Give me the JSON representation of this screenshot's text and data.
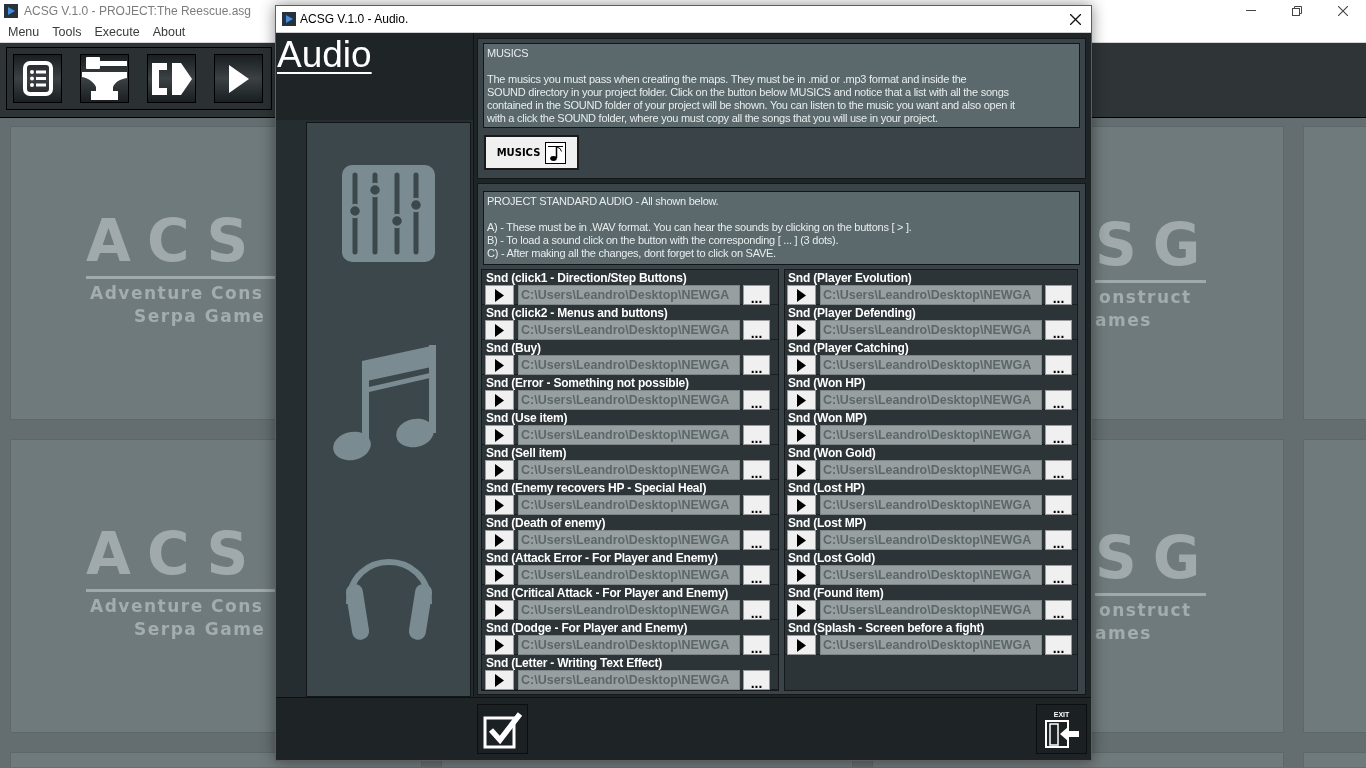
{
  "main_window": {
    "title": "ACSG V.1.0 - PROJECT:The Reescue.asg",
    "menu": [
      {
        "label": "Menu"
      },
      {
        "label": "Tools"
      },
      {
        "label": "Execute"
      },
      {
        "label": "About"
      }
    ]
  },
  "workspace": {
    "tile_logos": [
      {
        "lines": [
          "ACS",
          "Adventure Cons",
          "Serpa Game"
        ]
      },
      {
        "lines": [
          "SG",
          "onstruct",
          "ames"
        ]
      },
      {
        "lines": [
          "ACS",
          "Adventure Cons",
          "Serpa Game"
        ]
      },
      {
        "lines": [
          "SG",
          "onstruct",
          "ames"
        ]
      }
    ]
  },
  "dialog": {
    "title": "ACSG V.1.0 - Audio.",
    "heading": "Audio",
    "musics": {
      "title": "MUSICS",
      "description": "The musics you must pass when creating the maps. They must be in .mid or .mp3 format and inside the\nSOUND directory in your project folder. Click on the button below MUSICS and notice that a list with all the songs\ncontained in the SOUND folder of your project will be shown. You can listen to the music you want and also open it\nwith a click the SOUND folder, where you must copy all the songs that you will use in your project.",
      "button": "MUSICS"
    },
    "standard_audio": {
      "title": "PROJECT STANDARD AUDIO - All shown below.",
      "notes": [
        "A) - These must be in .WAV format. You can hear the sounds by clicking on the buttons [ > ].",
        "B) - To load a sound click on the button with the corresponding [ ... ] (3 dots).",
        "C) - After making all the changes, dont forget to click on SAVE."
      ],
      "columns": [
        {
          "sounds": [
            {
              "label": "Snd (click1 - Direction/Step Buttons)",
              "path": "C:\\Users\\Leandro\\Desktop\\NEWGA",
              "disabled": true,
              "browse": "..."
            },
            {
              "label": "Snd (click2 - Menus and buttons)",
              "path": "C:\\Users\\Leandro\\Desktop\\NEWGA",
              "disabled": true,
              "browse": "..."
            },
            {
              "label": "Snd (Buy)",
              "path": "C:\\Users\\Leandro\\Desktop\\NEWGA",
              "disabled": true,
              "browse": "..."
            },
            {
              "label": "Snd (Error - Something not possible)",
              "path": "C:\\Users\\Leandro\\Desktop\\NEWGA",
              "disabled": true,
              "browse": "..."
            },
            {
              "label": "Snd (Use item)",
              "path": "C:\\Users\\Leandro\\Desktop\\NEWGA",
              "disabled": true,
              "browse": "..."
            },
            {
              "label": "Snd (Sell item)",
              "path": "C:\\Users\\Leandro\\Desktop\\NEWGA",
              "disabled": true,
              "browse": "..."
            },
            {
              "label": "Snd (Enemy recovers HP - Special Heal)",
              "path": "C:\\Users\\Leandro\\Desktop\\NEWGA",
              "disabled": true,
              "browse": "..."
            },
            {
              "label": "Snd (Death of enemy)",
              "path": "C:\\Users\\Leandro\\Desktop\\NEWGA",
              "disabled": true,
              "browse": "..."
            },
            {
              "label": "Snd (Attack Error - For Player and Enemy)",
              "path": "C:\\Users\\Leandro\\Desktop\\NEWGA",
              "disabled": true,
              "browse": "..."
            },
            {
              "label": "Snd (Critical Attack - For Player and Enemy)",
              "path": "C:\\Users\\Leandro\\Desktop\\NEWGA",
              "disabled": true,
              "browse": "..."
            },
            {
              "label": "Snd (Dodge - For Player and Enemy)",
              "path": "C:\\Users\\Leandro\\Desktop\\NEWGA",
              "disabled": true,
              "browse": "..."
            },
            {
              "label": "Snd (Letter - Writing Text Effect)",
              "path": "C:\\Users\\Leandro\\Desktop\\NEWGA",
              "disabled": true,
              "browse": "..."
            }
          ]
        },
        {
          "sounds": [
            {
              "label": "Snd (Player Evolution)",
              "path": "C:\\Users\\Leandro\\Desktop\\NEWGA",
              "disabled": true,
              "browse": "..."
            },
            {
              "label": "Snd (Player Defending)",
              "path": "C:\\Users\\Leandro\\Desktop\\NEWGA",
              "disabled": true,
              "browse": "..."
            },
            {
              "label": "Snd (Player Catching)",
              "path": "C:\\Users\\Leandro\\Desktop\\NEWGA",
              "disabled": true,
              "browse": "..."
            },
            {
              "label": "Snd (Won HP)",
              "path": "C:\\Users\\Leandro\\Desktop\\NEWGA",
              "disabled": true,
              "browse": "..."
            },
            {
              "label": "Snd (Won MP)",
              "path": "C:\\Users\\Leandro\\Desktop\\NEWGA",
              "disabled": true,
              "browse": "..."
            },
            {
              "label": "Snd (Won Gold)",
              "path": "C:\\Users\\Leandro\\Desktop\\NEWGA",
              "disabled": true,
              "browse": "..."
            },
            {
              "label": "Snd (Lost HP)",
              "path": "C:\\Users\\Leandro\\Desktop\\NEWGA",
              "disabled": true,
              "browse": "..."
            },
            {
              "label": "Snd (Lost MP)",
              "path": "C:\\Users\\Leandro\\Desktop\\NEWGA",
              "disabled": true,
              "browse": "..."
            },
            {
              "label": "Snd (Lost Gold)",
              "path": "C:\\Users\\Leandro\\Desktop\\NEWGA",
              "disabled": true,
              "browse": "..."
            },
            {
              "label": "Snd (Found item)",
              "path": "C:\\Users\\Leandro\\Desktop\\NEWGA",
              "disabled": true,
              "browse": "..."
            },
            {
              "label": "Snd (Splash - Screen before a fight)",
              "path": "C:\\Users\\Leandro\\Desktop\\NEWGA",
              "disabled": true,
              "browse": "..."
            }
          ]
        }
      ]
    },
    "exit_button": {
      "label": "EXIT"
    }
  }
}
